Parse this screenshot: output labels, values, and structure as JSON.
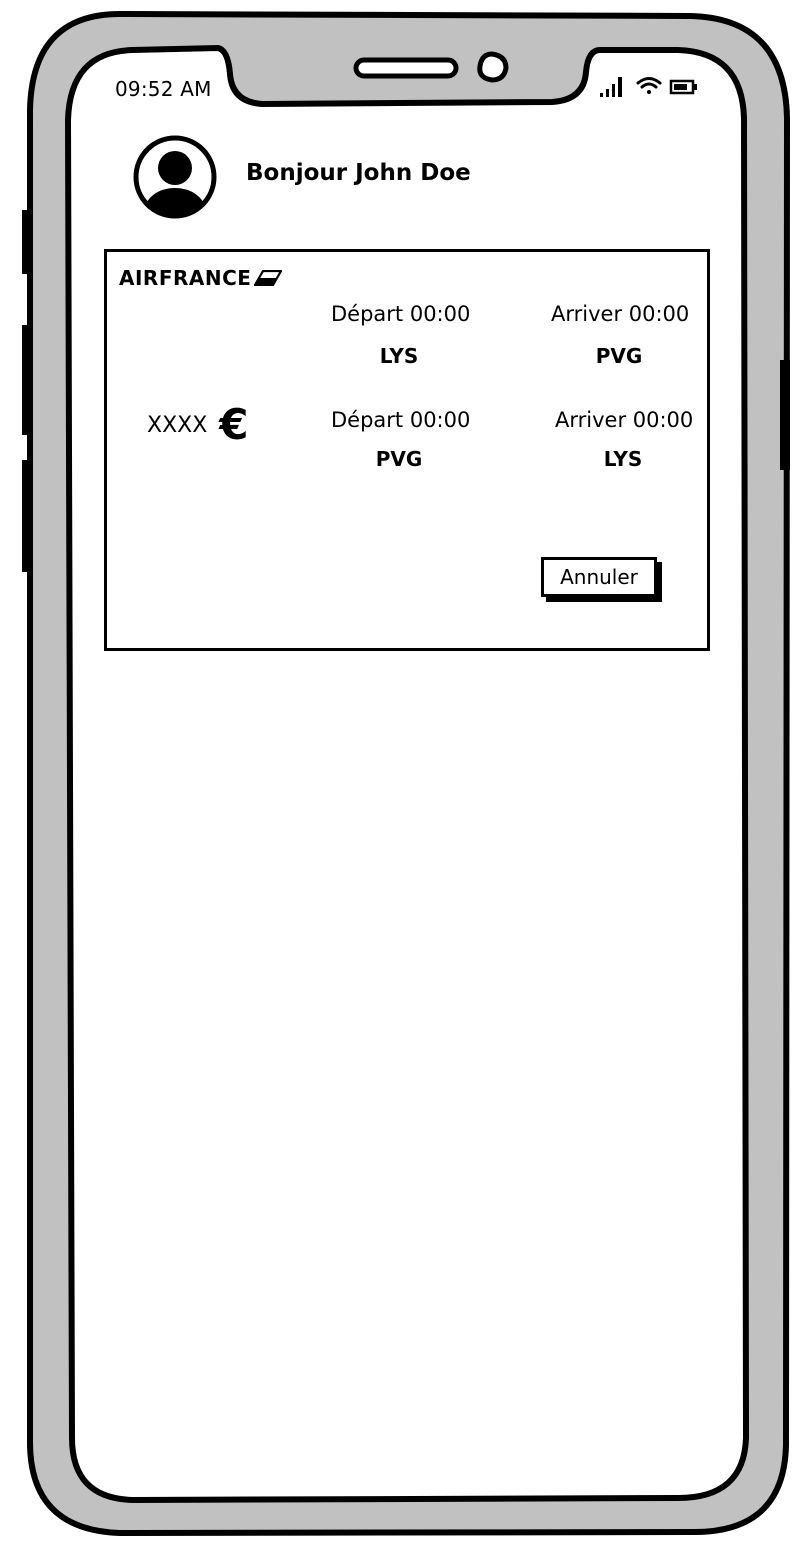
{
  "status_bar": {
    "time": "09:52 AM",
    "icons": [
      "signal-icon",
      "wifi-icon",
      "battery-icon"
    ]
  },
  "header": {
    "greeting": "Bonjour John Doe",
    "avatar_icon": "user-avatar-icon"
  },
  "booking": {
    "airline": "AIRFRANCE",
    "outbound": {
      "departure_label": "Départ 00:00",
      "arrival_label": "Arriver 00:00",
      "from": "LYS",
      "to": "PVG"
    },
    "return": {
      "departure_label": "Départ 00:00",
      "arrival_label": "Arriver 00:00",
      "from": "PVG",
      "to": "LYS"
    },
    "price": "XXXX",
    "currency_symbol": "€",
    "cancel_label": "Annuler"
  }
}
